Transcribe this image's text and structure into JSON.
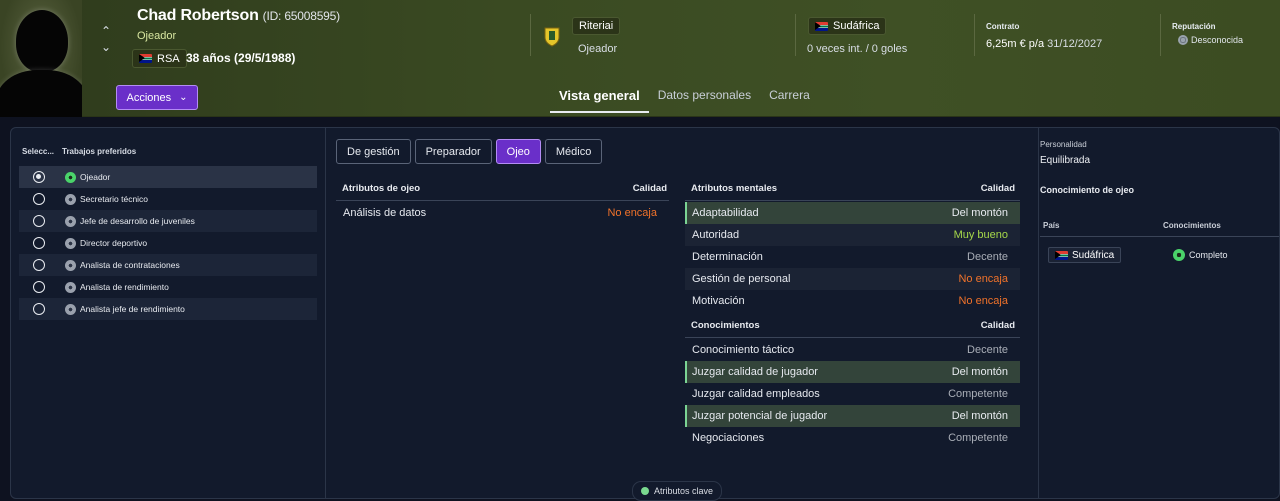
{
  "player": {
    "name": "Chad Robertson",
    "id_text": "(ID: 65008595)",
    "role": "Ojeador",
    "nation_code": "RSA",
    "age_text": "38 años (29/5/1988)"
  },
  "header": {
    "actions_label": "Acciones",
    "club_name": "Riteriai",
    "club_role": "Ojeador",
    "nationality": "Sudáfrica",
    "international": "0 veces int. / 0 goles",
    "contract_label": "Contrato",
    "contract_value": "6,25m € p/a",
    "contract_date": "31/12/2027",
    "reputation_label": "Reputación",
    "reputation_value": "Desconocida",
    "tabs": [
      {
        "label": "Vista general",
        "active": true
      },
      {
        "label": "Datos personales",
        "active": false
      },
      {
        "label": "Carrera",
        "active": false
      }
    ]
  },
  "jobs": {
    "col_select": "Selecc...",
    "col_jobs": "Trabajos preferidos",
    "items": [
      {
        "label": "Ojeador",
        "selected": true,
        "icon": "green"
      },
      {
        "label": "Secretario técnico",
        "selected": false,
        "icon": "gray"
      },
      {
        "label": "Jefe de desarrollo de juveniles",
        "selected": false,
        "icon": "gray"
      },
      {
        "label": "Director deportivo",
        "selected": false,
        "icon": "gray"
      },
      {
        "label": "Analista de contrataciones",
        "selected": false,
        "icon": "gray"
      },
      {
        "label": "Analista de rendimiento",
        "selected": false,
        "icon": "gray"
      },
      {
        "label": "Analista jefe de rendimiento",
        "selected": false,
        "icon": "gray"
      }
    ]
  },
  "subtabs": [
    {
      "label": "De gestión",
      "active": false
    },
    {
      "label": "Preparador",
      "active": false
    },
    {
      "label": "Ojeo",
      "active": true
    },
    {
      "label": "Médico",
      "active": false
    }
  ],
  "scouting_attrs": {
    "title": "Atributos de ojeo",
    "quality_label": "Calidad",
    "rows": [
      {
        "name": "Análisis de datos",
        "value": "No encaja",
        "tone": "bad"
      }
    ]
  },
  "mental_attrs": {
    "title": "Atributos mentales",
    "quality_label": "Calidad",
    "rows": [
      {
        "name": "Adaptabilidad",
        "value": "Del montón",
        "tone": "avg",
        "hl": true
      },
      {
        "name": "Autoridad",
        "value": "Muy bueno",
        "tone": "good"
      },
      {
        "name": "Determinación",
        "value": "Decente",
        "tone": "ok"
      },
      {
        "name": "Gestión de personal",
        "value": "No encaja",
        "tone": "bad"
      },
      {
        "name": "Motivación",
        "value": "No encaja",
        "tone": "bad"
      }
    ]
  },
  "knowledge_attrs": {
    "title": "Conocimientos",
    "quality_label": "Calidad",
    "rows": [
      {
        "name": "Conocimiento táctico",
        "value": "Decente",
        "tone": "ok"
      },
      {
        "name": "Juzgar calidad de jugador",
        "value": "Del montón",
        "tone": "avg",
        "hl": true
      },
      {
        "name": "Juzgar calidad empleados",
        "value": "Competente",
        "tone": "ok"
      },
      {
        "name": "Juzgar potencial de jugador",
        "value": "Del montón",
        "tone": "avg",
        "hl": true
      },
      {
        "name": "Negociaciones",
        "value": "Competente",
        "tone": "ok"
      }
    ]
  },
  "side": {
    "personality_label": "Personalidad",
    "personality_value": "Equilibrada",
    "scout_knowledge_title": "Conocimiento de ojeo",
    "col_country": "País",
    "col_knowledge": "Conocimientos",
    "country": "Sudáfrica",
    "knowledge_level": "Completo"
  },
  "legend": {
    "label": "Atributos clave"
  }
}
